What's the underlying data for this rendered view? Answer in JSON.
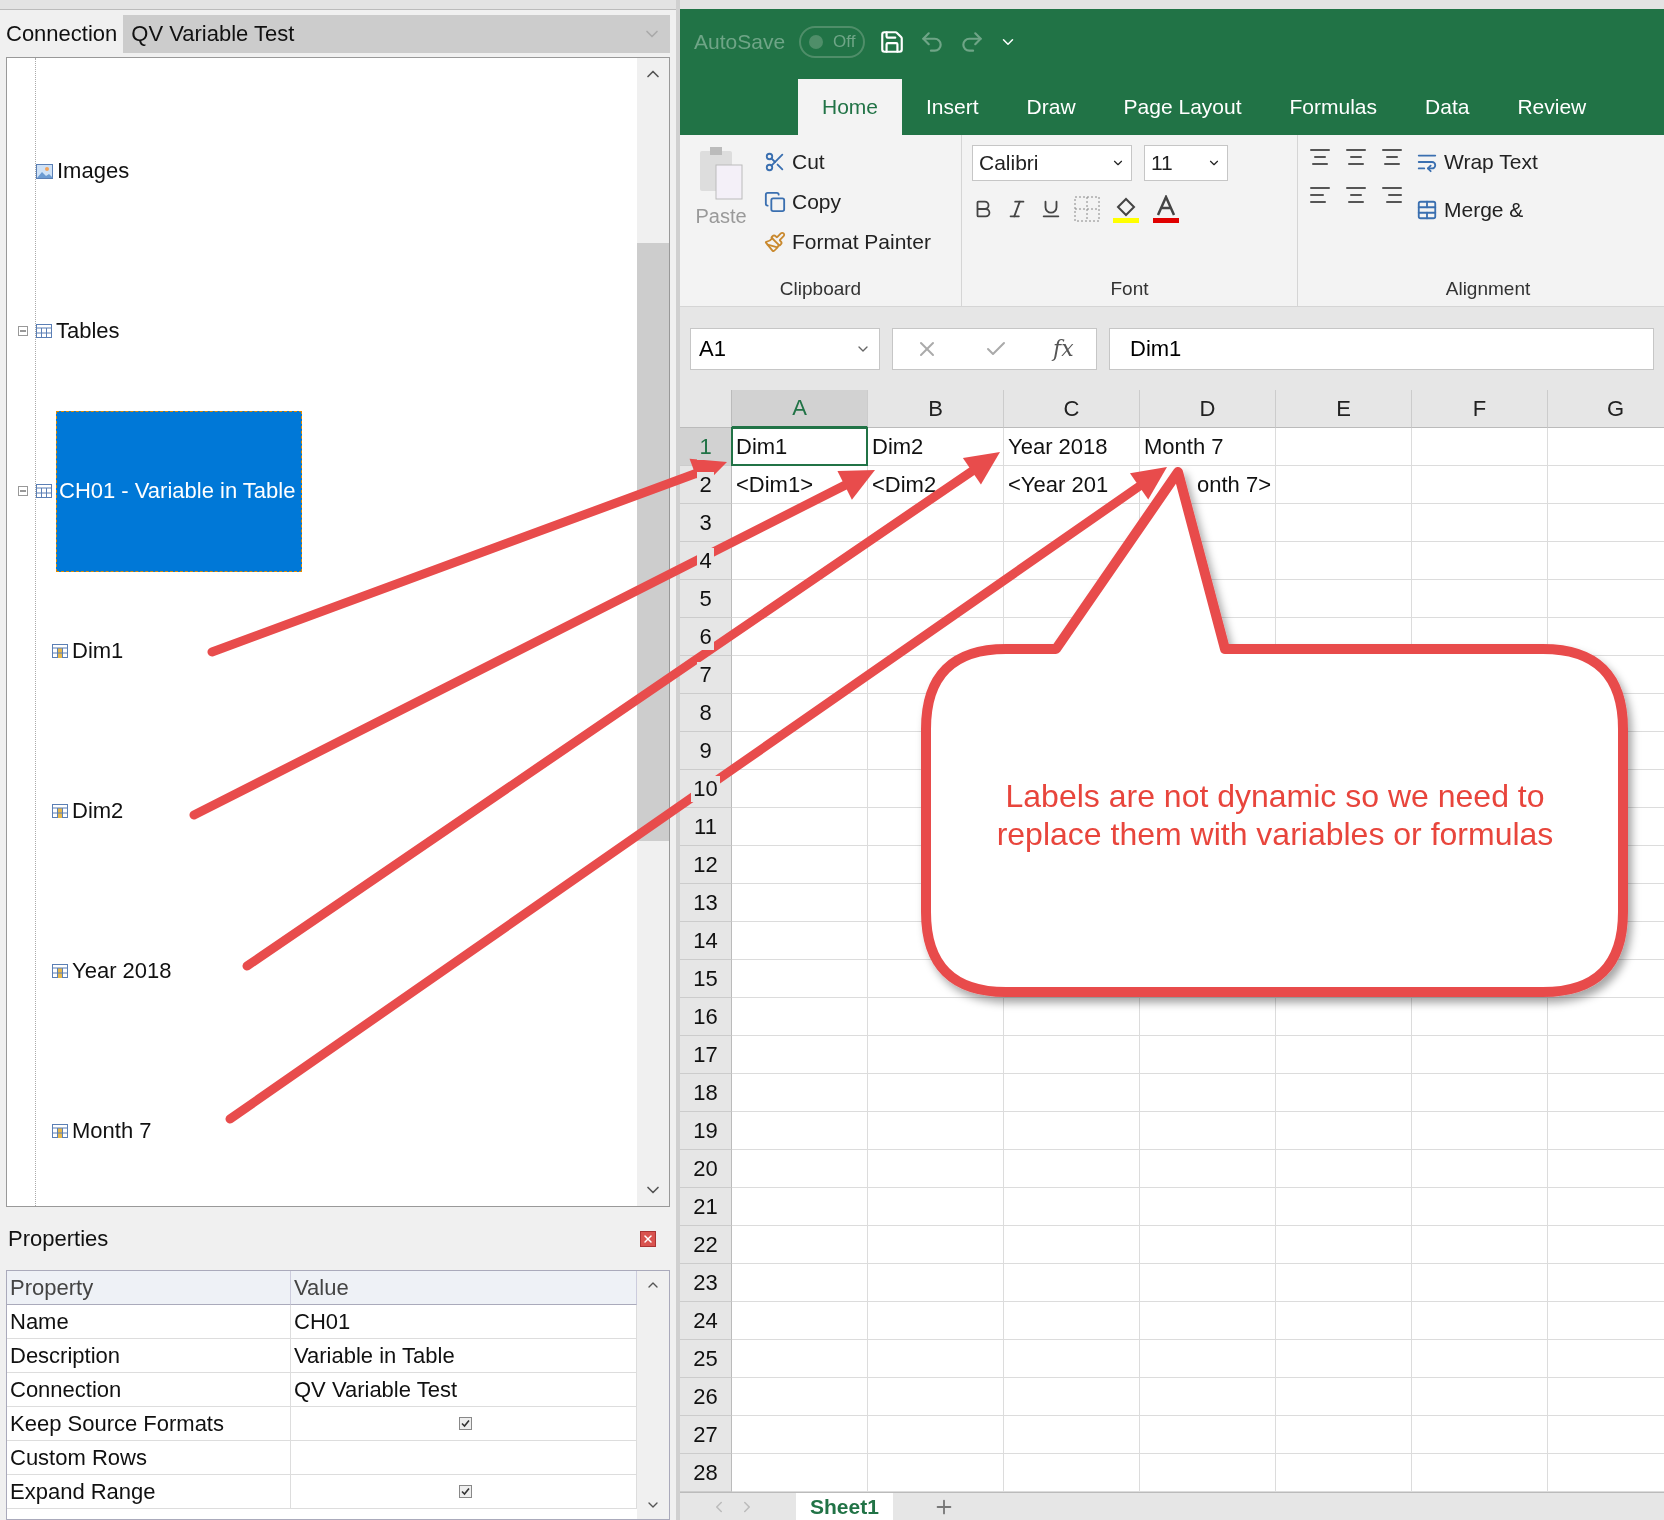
{
  "connection": {
    "label": "Connection",
    "value": "QV Variable Test"
  },
  "tree": [
    {
      "label": "Images",
      "kind": "images"
    },
    {
      "label": "Tables",
      "kind": "table",
      "expanded": true,
      "selected": false,
      "children": [
        {
          "label": "CH01 - Variable in Table",
          "kind": "table",
          "expanded": true,
          "selected": true,
          "children": [
            {
              "label": "Dim1",
              "kind": "field",
              "selected": false
            },
            {
              "label": "Dim2",
              "kind": "field",
              "selected": false
            },
            {
              "label": "Year 2018",
              "kind": "field",
              "selected": false
            },
            {
              "label": "Month 7",
              "kind": "field",
              "selected": false
            }
          ]
        }
      ]
    }
  ],
  "properties": {
    "title": "Properties",
    "columns": [
      "Property",
      "Value"
    ],
    "rows": [
      {
        "name": "Name",
        "kind": "text",
        "value": "CH01"
      },
      {
        "name": "Description",
        "kind": "text",
        "value": "Variable in Table"
      },
      {
        "name": "Connection",
        "kind": "text",
        "value": "QV Variable Test"
      },
      {
        "name": "Keep Source Formats",
        "kind": "checkbox",
        "checked": true
      },
      {
        "name": "Custom Rows",
        "kind": "text"
      },
      {
        "name": "Expand Range",
        "kind": "checkbox",
        "checked": true
      }
    ]
  },
  "excel": {
    "autosave": {
      "label": "AutoSave",
      "state": "Off",
      "on": false
    },
    "tabs": [
      {
        "label": "Home",
        "selected": true
      },
      {
        "label": "Insert",
        "selected": false
      },
      {
        "label": "Draw",
        "selected": false
      },
      {
        "label": "Page Layout",
        "selected": false
      },
      {
        "label": "Formulas",
        "selected": false
      },
      {
        "label": "Data",
        "selected": false
      },
      {
        "label": "Review",
        "selected": false
      }
    ],
    "clipboard": {
      "paste": "Paste",
      "items": [
        "Cut",
        "Copy",
        "Format Painter"
      ],
      "group": "Clipboard"
    },
    "font": {
      "name": "Calibri",
      "size": "11",
      "group": "Font"
    },
    "alignment": {
      "wrap": "Wrap Text",
      "merge": "Merge &",
      "group": "Alignment"
    },
    "name_box": "A1",
    "fx": "fx",
    "formula": "Dim1",
    "columns": [
      {
        "label": "A",
        "selected": true
      },
      {
        "label": "B",
        "selected": false
      },
      {
        "label": "C",
        "selected": false
      },
      {
        "label": "D",
        "selected": false
      },
      {
        "label": "E",
        "selected": false
      },
      {
        "label": "F",
        "selected": false
      },
      {
        "label": "G",
        "selected": false
      }
    ],
    "rows": [
      {
        "number": "1",
        "selected": true,
        "cells": [
          {
            "text": "Dim1",
            "selected": true
          },
          {
            "text": "Dim2",
            "selected": false
          },
          {
            "text": "Year 2018",
            "selected": false
          },
          {
            "text": "Month 7",
            "selected": false
          }
        ]
      },
      {
        "number": "2",
        "selected": false,
        "cells": [
          {
            "text": "<Dim1>",
            "selected": false
          },
          {
            "text": "<Dim2",
            "selected": false
          },
          {
            "text": "<Year 201",
            "selected": false
          },
          {
            "text": "onth 7>",
            "selected": false,
            "kind": "clipped"
          }
        ]
      },
      {
        "number": "3",
        "selected": false
      },
      {
        "number": "4",
        "selected": false
      },
      {
        "number": "5",
        "selected": false
      },
      {
        "number": "6",
        "selected": false
      },
      {
        "number": "7",
        "selected": false
      },
      {
        "number": "8",
        "selected": false
      },
      {
        "number": "9",
        "selected": false
      },
      {
        "number": "10",
        "selected": false
      },
      {
        "number": "11",
        "selected": false
      },
      {
        "number": "12",
        "selected": false
      },
      {
        "number": "13",
        "selected": false
      },
      {
        "number": "14",
        "selected": false
      },
      {
        "number": "15",
        "selected": false
      },
      {
        "number": "16",
        "selected": false
      },
      {
        "number": "17",
        "selected": false
      },
      {
        "number": "18",
        "selected": false
      },
      {
        "number": "19",
        "selected": false
      },
      {
        "number": "20",
        "selected": false
      },
      {
        "number": "21",
        "selected": false
      },
      {
        "number": "22",
        "selected": false
      },
      {
        "number": "23",
        "selected": false
      },
      {
        "number": "24",
        "selected": false
      },
      {
        "number": "25",
        "selected": false
      },
      {
        "number": "26",
        "selected": false
      },
      {
        "number": "27",
        "selected": false
      },
      {
        "number": "28",
        "selected": false
      }
    ],
    "sheets": [
      {
        "label": "Sheet1",
        "selected": true
      }
    ]
  },
  "callout": {
    "text": "Labels are not dynamic so we need to replace them with variables or formulas"
  }
}
